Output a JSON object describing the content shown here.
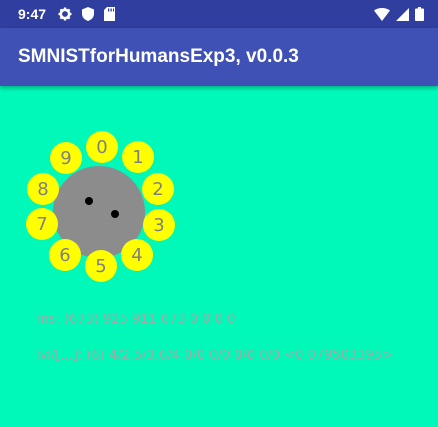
{
  "status_bar": {
    "time": "9:47",
    "left_icons": [
      "settings-gear-icon",
      "shield-icon",
      "sd-card-icon"
    ],
    "right_icons": [
      "wifi-icon",
      "signal-icon",
      "battery-icon"
    ]
  },
  "app_bar": {
    "title": "SMNISTforHumansExp3, v0.0.3",
    "color": "#3F51B5"
  },
  "dial": {
    "digits": [
      "0",
      "1",
      "2",
      "3",
      "4",
      "5",
      "6",
      "7",
      "8",
      "9"
    ],
    "digit_color": "#FFFF00",
    "center_color": "#8C8C8C"
  },
  "stats": {
    "ms_line": "ms: (673) 925 911 673 0 0 0 0",
    "lvl_line": "lvl/[...]: (6) 4/2.5/3.6/4 0/0 0/0 0/0 0/0  <0.079503395>"
  },
  "background_color": "#00F8B8"
}
